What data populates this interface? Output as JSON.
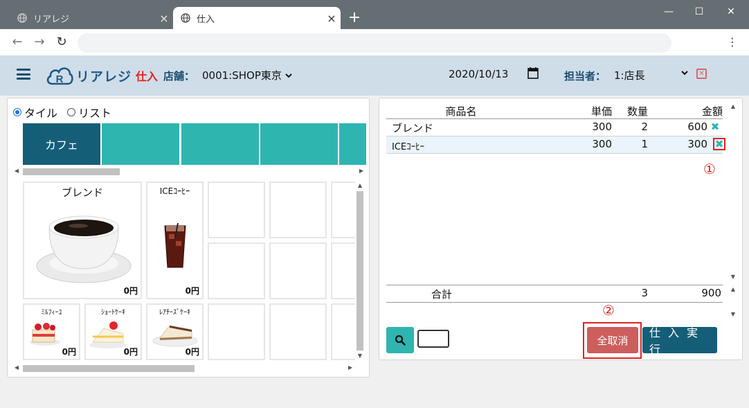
{
  "browser": {
    "tabs": [
      {
        "title": "リアレジ",
        "active": false
      },
      {
        "title": "仕入",
        "active": true
      }
    ],
    "new_tab_label": "+",
    "close_label": "×",
    "window_controls": {
      "minimize": "—",
      "maximize": "☐",
      "close": "✕"
    },
    "nav": {
      "back": "←",
      "forward": "→",
      "reload": "↻",
      "menu": "⋮"
    }
  },
  "header": {
    "logo_text": "リアレジ",
    "logo_letter": "R",
    "mode": "仕入",
    "store_label": "店舗：",
    "store_value": "0001:SHOP東京",
    "date": "2020/10/13",
    "staff_label": "担当者：",
    "staff_value": "1:店長",
    "colors": {
      "header_bg": "#cfdde9",
      "accent": "#1a4d6e",
      "mode_red": "#e0221d"
    }
  },
  "view_mode": {
    "options": [
      {
        "label": "タイル",
        "selected": true
      },
      {
        "label": "リスト",
        "selected": false
      }
    ]
  },
  "categories": [
    {
      "label": "カフェ",
      "selected": true
    },
    {
      "label": "",
      "selected": false
    },
    {
      "label": "",
      "selected": false
    },
    {
      "label": "",
      "selected": false
    },
    {
      "label": ""
    }
  ],
  "products": [
    {
      "name": "ブレンド",
      "price": "0円",
      "icon": "coffee-cup"
    },
    {
      "name": "ICEｺｰﾋｰ",
      "price": "0円",
      "icon": "iced-coffee"
    },
    {
      "name": "ﾐﾙﾌｨｰﾕ",
      "price": "0円",
      "icon": "mille-feuille"
    },
    {
      "name": "ｼｮｰﾄｹｰｷ",
      "price": "0円",
      "icon": "shortcake"
    },
    {
      "name": "ﾚｱﾁｰｽﾞｹｰｷ",
      "price": "0円",
      "icon": "cheesecake"
    }
  ],
  "cart": {
    "headers": {
      "name": "商品名",
      "price": "単価",
      "qty": "数量",
      "amount": "金額"
    },
    "rows": [
      {
        "name": "ブレンド",
        "price": "300",
        "qty": "2",
        "amount": "600"
      },
      {
        "name": "ICEｺｰﾋｰ",
        "price": "300",
        "qty": "1",
        "amount": "300"
      }
    ],
    "total": {
      "label": "合計",
      "qty": "3",
      "amount": "900"
    },
    "delete_label": "✖",
    "annotation_1": "①",
    "annotation_2": "②",
    "cancel_all_label": "全取消",
    "execute_label": "仕入実行"
  }
}
